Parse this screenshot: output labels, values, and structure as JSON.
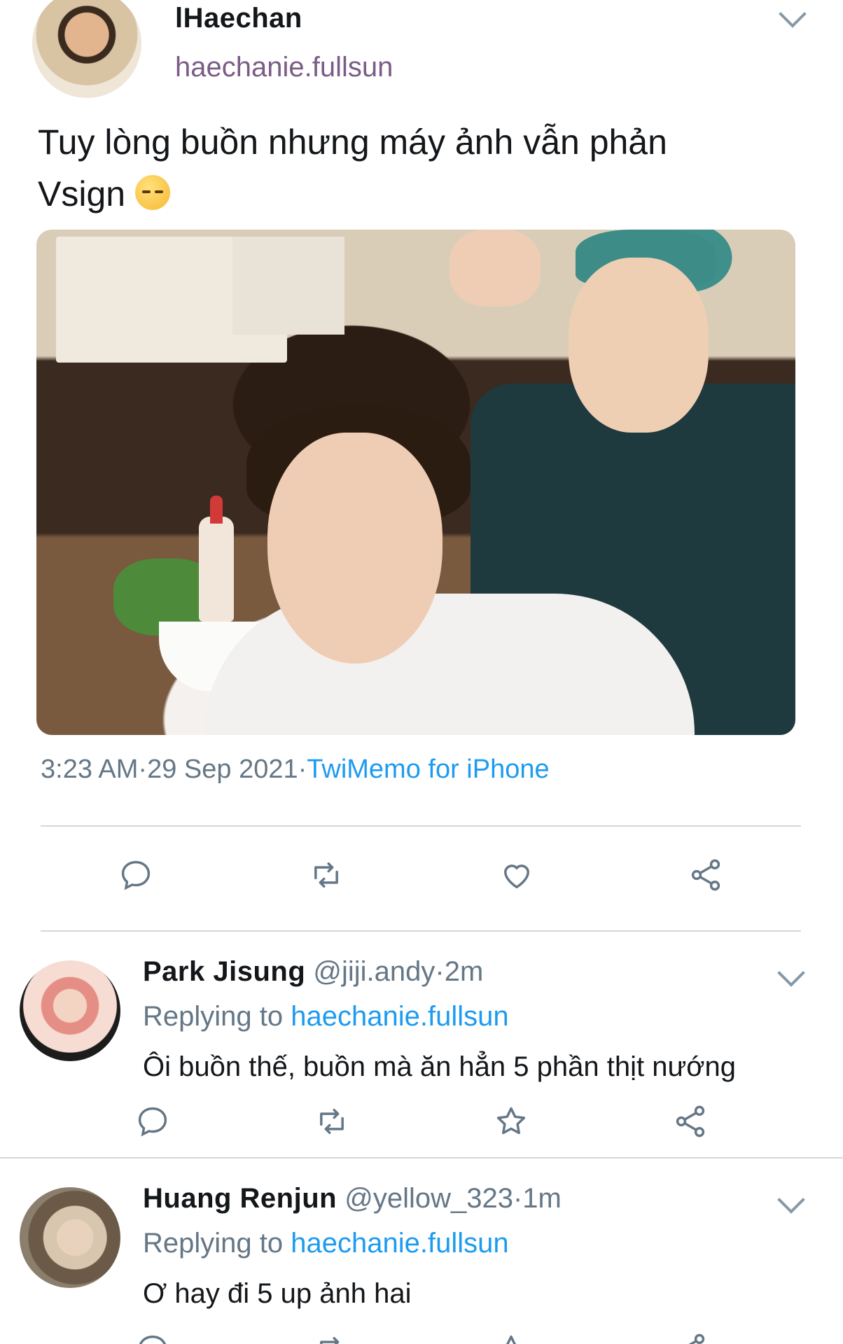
{
  "main_tweet": {
    "display_name": "lHaechan",
    "handle": "haechanie.fullsun",
    "text_line1": "Tuy lòng buồn nhưng máy ảnh vẫn phản",
    "text_line2": "Vsign",
    "emoji": "pensive-face-emoji",
    "time": "3:23 AM",
    "date": "29 Sep 2021",
    "source": "TwiMemo for iPhone",
    "separator": "·"
  },
  "replies": [
    {
      "display_name": "Park Jisung",
      "handle": "@jiji.andy",
      "time": "·2m",
      "replying_label": "Replying to",
      "replying_to": "haechanie.fullsun",
      "text": "Ôi buồn thế, buồn mà ăn hẳn 5 phần thịt nướng"
    },
    {
      "display_name": "Huang Renjun",
      "handle": "@yellow_323",
      "time": "·1m",
      "replying_label": "Replying to",
      "replying_to": "haechanie.fullsun",
      "text": "Ơ hay đi 5 up ảnh hai"
    }
  ],
  "icons": {
    "reply": "reply-icon",
    "retweet": "retweet-icon",
    "like": "heart-icon",
    "favorite": "star-icon",
    "share": "share-icon",
    "menu": "chevron-down-icon"
  },
  "colors": {
    "link": "#1d9bf0",
    "secondary": "#657786",
    "icon": "#657786"
  }
}
